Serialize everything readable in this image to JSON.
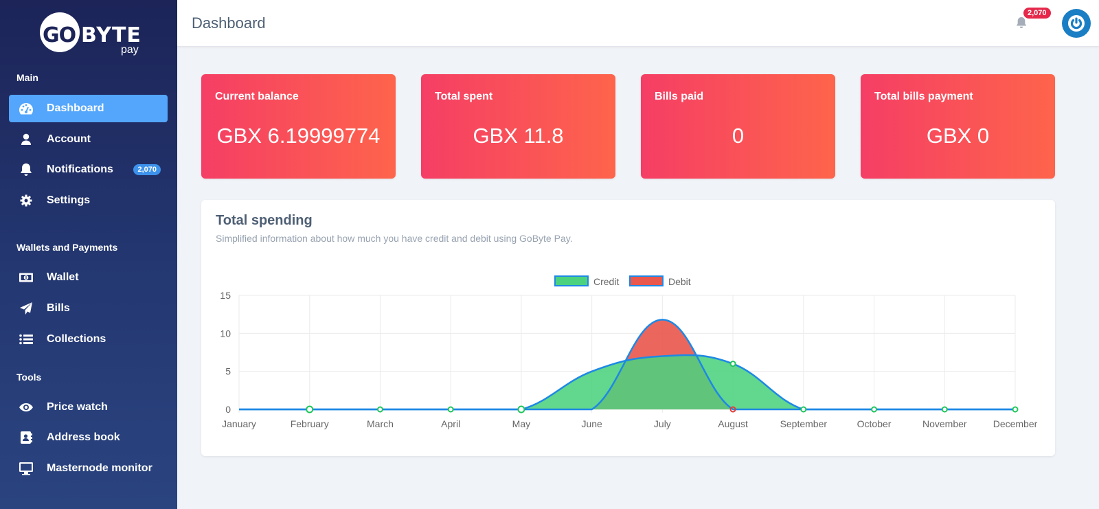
{
  "brand": {
    "logo_left": "GO",
    "logo_right": "BYTE",
    "logo_sub": "pay"
  },
  "sidebar": {
    "sections": [
      {
        "label": "Main",
        "items": [
          {
            "label": "Dashboard",
            "icon": "dashboard-icon",
            "active": true
          },
          {
            "label": "Account",
            "icon": "user-icon"
          },
          {
            "label": "Notifications",
            "icon": "bell-icon",
            "badge": "2,070"
          },
          {
            "label": "Settings",
            "icon": "gear-icon"
          }
        ]
      },
      {
        "label": "Wallets and Payments",
        "items": [
          {
            "label": "Wallet",
            "icon": "money-bill-icon"
          },
          {
            "label": "Bills",
            "icon": "paper-plane-icon"
          },
          {
            "label": "Collections",
            "icon": "list-icon"
          }
        ]
      },
      {
        "label": "Tools",
        "items": [
          {
            "label": "Price watch",
            "icon": "eye-icon"
          },
          {
            "label": "Address book",
            "icon": "address-book-icon"
          },
          {
            "label": "Masternode monitor",
            "icon": "desktop-icon"
          }
        ]
      }
    ]
  },
  "header": {
    "title": "Dashboard",
    "notification_count": "2,070"
  },
  "stats": [
    {
      "title": "Current balance",
      "value": "GBX 6.19999774"
    },
    {
      "title": "Total spent",
      "value": "GBX 11.8"
    },
    {
      "title": "Bills paid",
      "value": "0"
    },
    {
      "title": "Total bills payment",
      "value": "GBX 0"
    }
  ],
  "spending": {
    "title": "Total spending",
    "subtitle": "Simplified information about how much you have credit and debit using GoByte Pay."
  },
  "colors": {
    "credit_fill": "#4cd27e",
    "debit_fill": "#e9574d",
    "line": "#1e88e5",
    "point": "#1ec65a",
    "debit_point": "#e53935",
    "card_gradient_start": "#f53e65",
    "card_gradient_end": "#fe644b",
    "active_nav": "#53a6fb"
  },
  "chart_data": {
    "type": "area",
    "title": "",
    "categories": [
      "January",
      "February",
      "March",
      "April",
      "May",
      "June",
      "July",
      "August",
      "September",
      "October",
      "November",
      "December"
    ],
    "series": [
      {
        "name": "Credit",
        "values": [
          0,
          0,
          0,
          0,
          0,
          5,
          7,
          6,
          0,
          0,
          0,
          0
        ]
      },
      {
        "name": "Debit",
        "values": [
          0,
          0,
          0,
          0,
          0,
          0,
          11.8,
          0,
          0,
          0,
          0,
          0
        ]
      }
    ],
    "yticks": [
      0,
      5,
      10,
      15
    ],
    "ylim": [
      0,
      15
    ],
    "xlabel": "",
    "ylabel": "",
    "grid": true,
    "legend": "top-center"
  }
}
